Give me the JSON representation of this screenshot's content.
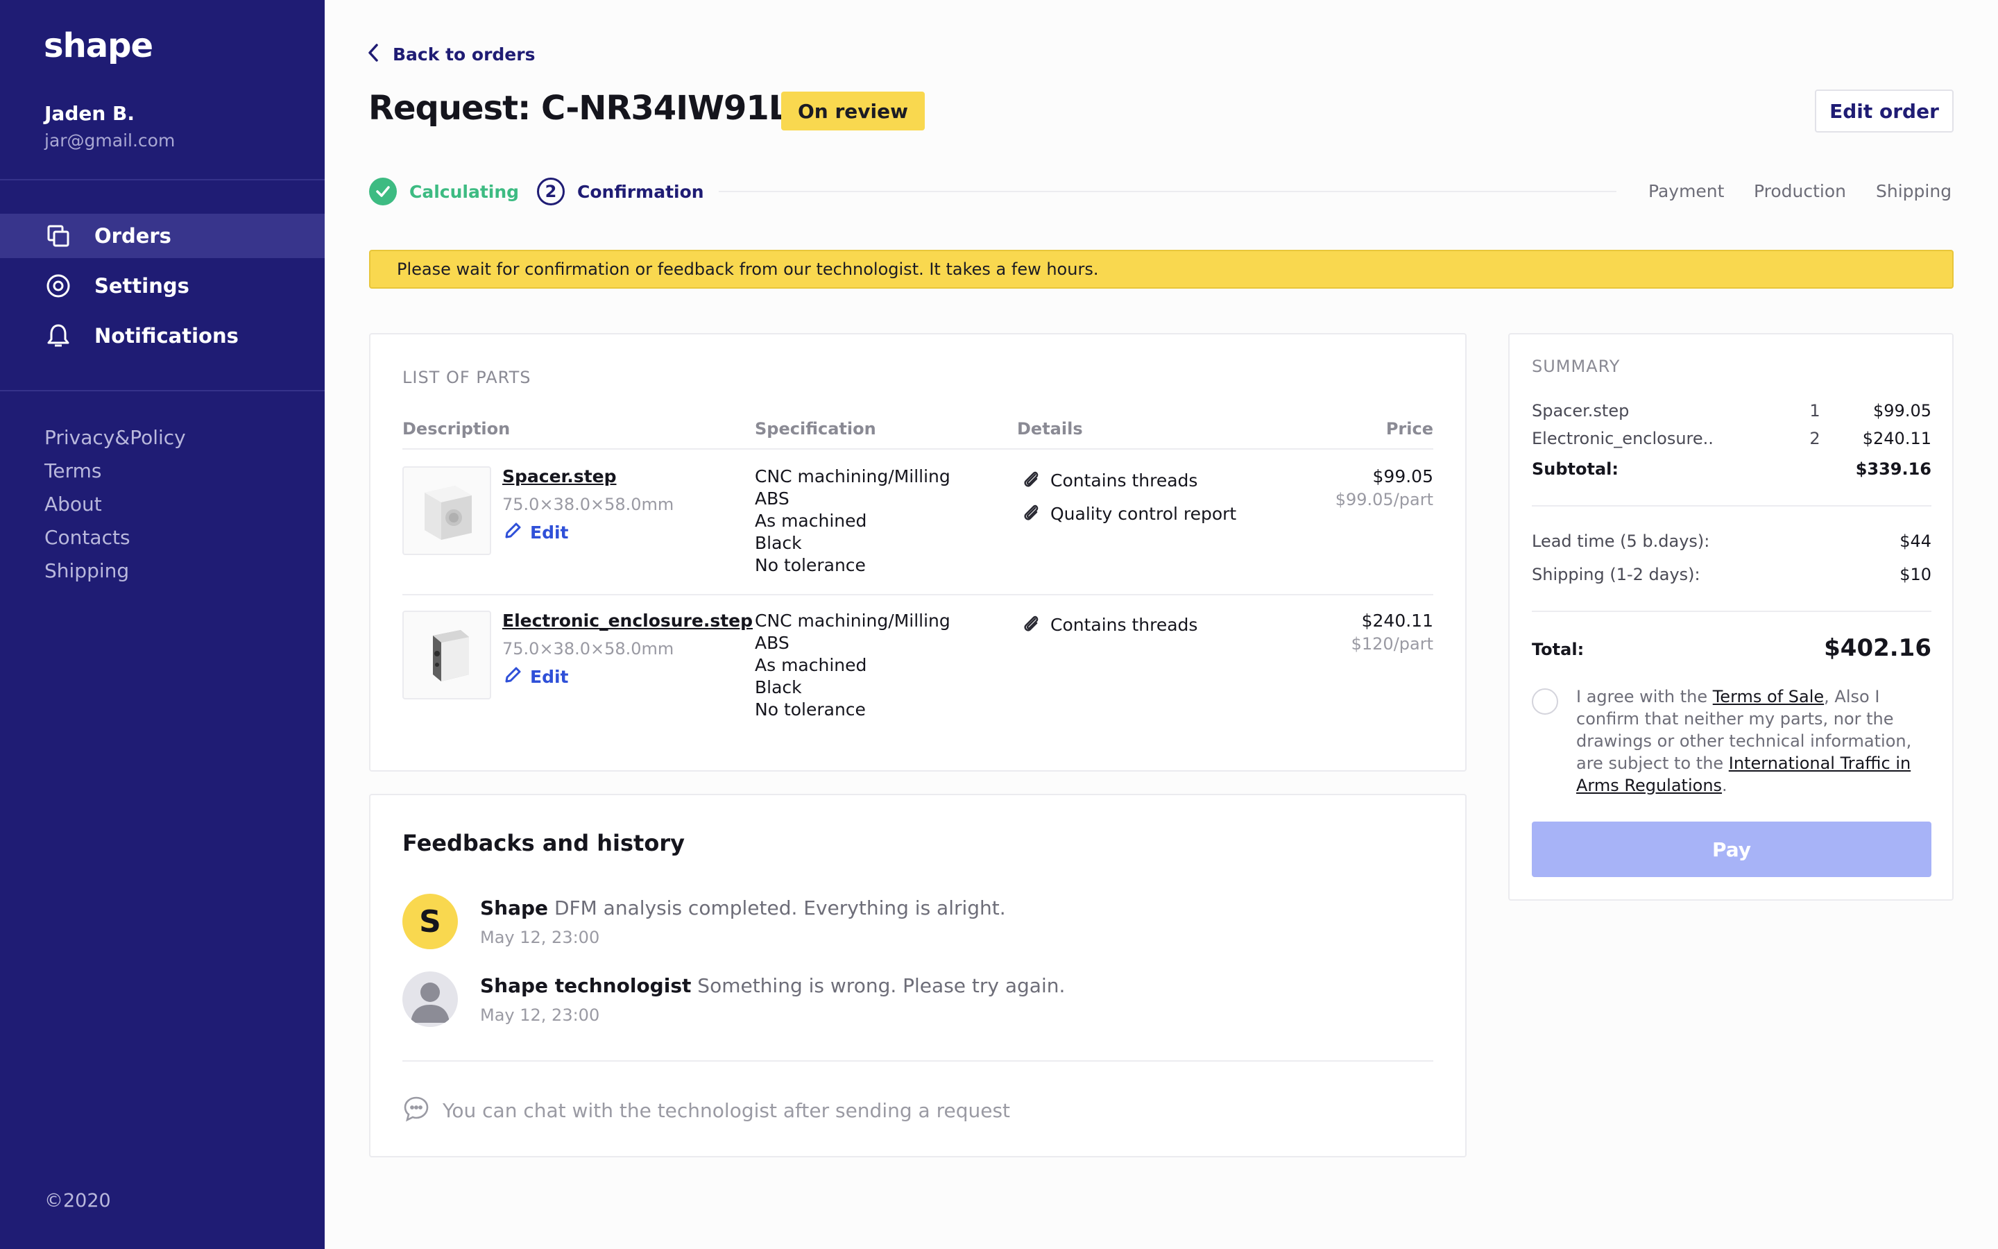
{
  "sidebar": {
    "logo": "shape",
    "user": {
      "name": "Jaden B.",
      "email": "jar@gmail.com"
    },
    "nav": [
      {
        "label": "Orders",
        "icon": "copy-icon",
        "active": true
      },
      {
        "label": "Settings",
        "icon": "settings-icon",
        "active": false
      },
      {
        "label": "Notifications",
        "icon": "bell-icon",
        "active": false
      }
    ],
    "links": [
      "Privacy&Policy",
      "Terms",
      "About",
      "Contacts",
      "Shipping"
    ],
    "copyright": "©2020"
  },
  "header": {
    "back_label": "Back to orders",
    "title": "Request: C-NR34IW91LA",
    "status": "On review",
    "edit_label": "Edit order"
  },
  "steps": {
    "completed": "Calculating",
    "current_number": "2",
    "current": "Confirmation",
    "upcoming": [
      "Payment",
      "Production",
      "Shipping"
    ]
  },
  "banner": "Please wait for confirmation or feedback from our technologist. It takes a few hours.",
  "parts": {
    "section_title": "LIST OF PARTS",
    "columns": [
      "Description",
      "Specification",
      "Details",
      "Price"
    ],
    "edit_label": "Edit",
    "rows": [
      {
        "name": "Spacer.step",
        "dims": "75.0×38.0×58.0mm",
        "spec": [
          "CNC machining/Milling",
          "ABS",
          "As machined",
          "Black",
          "No tolerance"
        ],
        "details": [
          "Contains threads",
          "Quality control report"
        ],
        "price": "$99.05",
        "unit_price": "$99.05/part"
      },
      {
        "name": "Electronic_enclosure.step",
        "dims": "75.0×38.0×58.0mm",
        "spec": [
          "CNC machining/Milling",
          "ABS",
          "As machined",
          "Black",
          "No tolerance"
        ],
        "details": [
          "Contains threads"
        ],
        "price": "$240.11",
        "unit_price": "$120/part"
      }
    ]
  },
  "feedback": {
    "title": "Feedbacks and history",
    "items": [
      {
        "author": "Shape",
        "avatar_letter": "S",
        "text": "DFM analysis completed. Everything is alright.",
        "time": "May 12, 23:00"
      },
      {
        "author": "Shape technologist",
        "text": "Something is wrong. Please try again.",
        "time": "May 12, 23:00"
      }
    ],
    "chat_hint": "You can chat with the technologist after sending a request"
  },
  "summary": {
    "title": "SUMMARY",
    "items": [
      {
        "name": "Spacer.step",
        "qty": "1",
        "price": "$99.05"
      },
      {
        "name": "Electronic_enclosure..",
        "qty": "2",
        "price": "$240.11"
      }
    ],
    "subtotal_label": "Subtotal:",
    "subtotal": "$339.16",
    "lead_label": "Lead time (5 b.days):",
    "lead": "$44",
    "shipping_label": "Shipping (1-2 days):",
    "shipping": "$10",
    "total_label": "Total:",
    "total": "$402.16",
    "agree_pre": "I agree with the ",
    "terms_link": "Terms of Sale",
    "agree_mid": ", Also I confirm that neither my parts, nor the drawings or other technical information, are subject to the ",
    "itar_link": "International Traffic in Arms Regulations",
    "agree_post": ".",
    "pay_label": "Pay"
  },
  "colors": {
    "sidebar": "#1f1c74",
    "accent": "#2f50d8",
    "badge": "#f9d84f",
    "success": "#3dbb82",
    "pay_disabled": "#a7b3f7"
  }
}
